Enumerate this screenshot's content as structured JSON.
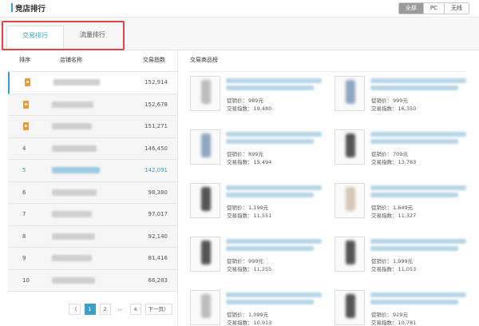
{
  "header": {
    "title": "竞店排行",
    "device_filters": [
      "全部",
      "PC",
      "无线"
    ],
    "active_filter_index": 0
  },
  "tabs": [
    {
      "label": "交易排行",
      "active": true
    },
    {
      "label": "流量排行",
      "active": false
    }
  ],
  "columns": {
    "rank": "排序",
    "shop_name": "店铺名称",
    "trade_index": "交易指数",
    "products": "交易商品榜"
  },
  "rows": [
    {
      "rank": "1",
      "score": "152,914",
      "medal": true,
      "selected": true
    },
    {
      "rank": "2",
      "score": "152,678",
      "medal": true
    },
    {
      "rank": "3",
      "score": "151,271",
      "medal": true
    },
    {
      "rank": "4",
      "score": "146,450"
    },
    {
      "rank": "5",
      "score": "142,091",
      "highlight": true
    },
    {
      "rank": "6",
      "score": "98,380"
    },
    {
      "rank": "7",
      "score": "97,017"
    },
    {
      "rank": "8",
      "score": "92,140"
    },
    {
      "rank": "9",
      "score": "81,416"
    },
    {
      "rank": "10",
      "score": "66,283"
    }
  ],
  "pagination": {
    "prev": "〈",
    "pages": [
      "1",
      "2",
      "...",
      "4"
    ],
    "current": "1",
    "next": "下一页〉"
  },
  "price_label": "促销价：",
  "index_label": "交易指数：",
  "products": [
    {
      "price": "989元",
      "index": "19,480"
    },
    {
      "price": "999元",
      "index": "16,350"
    },
    {
      "price": "899元",
      "index": "15,494"
    },
    {
      "price": "709元",
      "index": "13,783"
    },
    {
      "price": "1,199元",
      "index": "11,551"
    },
    {
      "price": "1,649元",
      "index": "11,327"
    },
    {
      "price": "999元",
      "index": "11,255"
    },
    {
      "price": "1,999元",
      "index": "11,053"
    },
    {
      "price": "1,099元",
      "index": "10,913"
    },
    {
      "price": "929元",
      "index": "10,781"
    }
  ],
  "colors": {
    "accent": "#3aa0c8",
    "medal": "#f09a2a",
    "annotation_box": "#e04646"
  }
}
